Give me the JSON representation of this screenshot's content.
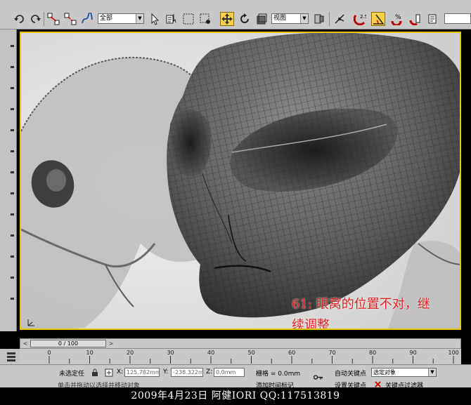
{
  "toolbar": {
    "selection_filter": "全部",
    "reference_coord": "视图",
    "snap_angle_label": "2.5",
    "percent_snap_label": "%",
    "buttons": [
      "undo-icon",
      "redo-icon",
      "select-link-icon",
      "unlink-icon",
      "bind-space-warp-icon",
      "select-object-icon",
      "select-by-name-icon",
      "rect-selection-icon",
      "window-crossing-icon",
      "move-icon",
      "rotate-icon",
      "scale-icon",
      "pivot-icon",
      "manipulate-icon",
      "snap-icon",
      "angle-snap-icon",
      "percent-snap-icon",
      "spinner-snap-icon"
    ]
  },
  "viewport": {
    "annotation_line1": "61: 眼窝的位置不对，继",
    "annotation_line2": "续调整",
    "border_color": "#e8c800",
    "annotation_color": "#e02020"
  },
  "timeline": {
    "frame_display": "0 / 100",
    "prev_label": "<",
    "next_label": ">",
    "ticks": [
      "0",
      "10",
      "20",
      "30",
      "40",
      "50",
      "60",
      "70",
      "80",
      "90",
      "100"
    ]
  },
  "statusbar": {
    "selection_status": "未选定任",
    "x_label": "X:",
    "x_value": "125.782mm",
    "y_label": "Y:",
    "y_value": "-238.322m",
    "z_label": "Z:",
    "z_value": "0.0mm",
    "grid_label": "栅格 = 0.0mm",
    "auto_key": "自动关键点",
    "selected_objects": "选定对象",
    "set_key": "设置关键点",
    "key_filters": "关键点过滤器",
    "prompt": "单击并拖动以选择并移动对象",
    "add_time_tag": "添加时间标记"
  },
  "footer": {
    "caption": "2009年4月23日 阿健IORI QQ:117513819"
  }
}
